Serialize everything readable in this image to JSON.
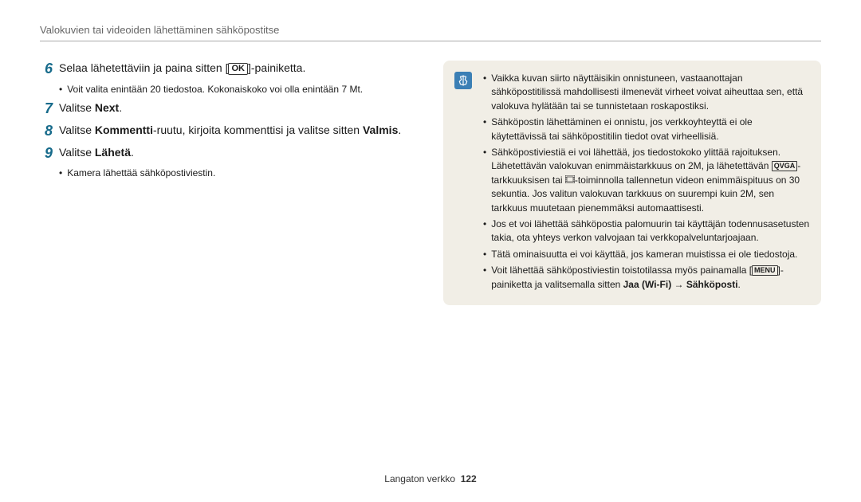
{
  "header": "Valokuvien tai videoiden lähettäminen sähköpostitse",
  "steps": [
    {
      "num": "6",
      "text_pre": "Selaa lähetettäviin ja paina sitten [",
      "ok": "OK",
      "text_post": "]-painiketta.",
      "sub": "Voit valita enintään 20 tiedostoa. Kokonaiskoko voi olla enintään 7 Mt."
    },
    {
      "num": "7",
      "text_pre": "Valitse ",
      "bold": "Next",
      "text_post": "."
    },
    {
      "num": "8",
      "text_pre": "Valitse ",
      "bold": "Kommentti",
      "text_mid": "-ruutu, kirjoita kommenttisi ja valitse sitten ",
      "bold2": "Valmis",
      "text_post": "."
    },
    {
      "num": "9",
      "text_pre": "Valitse ",
      "bold": "Lähetä",
      "text_post": ".",
      "sub": "Kamera lähettää sähköpostiviestin."
    }
  ],
  "note": {
    "items": [
      "Vaikka kuvan siirto näyttäisikin onnistuneen, vastaanottajan sähköpostitilissä mahdollisesti ilmenevät virheet voivat aiheuttaa sen, että valokuva hylätään tai se tunnistetaan roskapostiksi.",
      "Sähköpostin lähettäminen ei onnistu, jos verkkoyhteyttä ei ole käytettävissä tai sähköpostitilin tiedot ovat virheellisiä."
    ],
    "item3_a": "Sähköpostiviestiä ei voi lähettää, jos tiedostokoko ylittää rajoituksen. Lähetettävän valokuvan enimmäistarkkuus on 2M, ja lähetettävän ",
    "item3_qvga": "QVGA",
    "item3_b": "-tarkkuuksisen tai ",
    "item3_c": "-toiminnolla tallennetun videon enimmäispituus on 30 sekuntia. Jos valitun valokuvan tarkkuus on suurempi kuin 2M, sen tarkkuus muutetaan pienemmäksi automaattisesti.",
    "item4": "Jos et voi lähettää sähköpostia palomuurin tai käyttäjän todennusasetusten takia, ota yhteys verkon valvojaan tai verkkopalveluntarjoajaan.",
    "item5": "Tätä ominaisuutta ei voi käyttää, jos kameran muistissa ei ole tiedostoja.",
    "item6_a": "Voit lähettää sähköpostiviestin toistotilassa myös painamalla [",
    "item6_menu": "MENU",
    "item6_b": "]-painiketta ja valitsemalla sitten ",
    "item6_bold": "Jaa (Wi-Fi) → Sähköposti",
    "item6_c": "."
  },
  "footer": {
    "label": "Langaton verkko",
    "page": "122"
  }
}
